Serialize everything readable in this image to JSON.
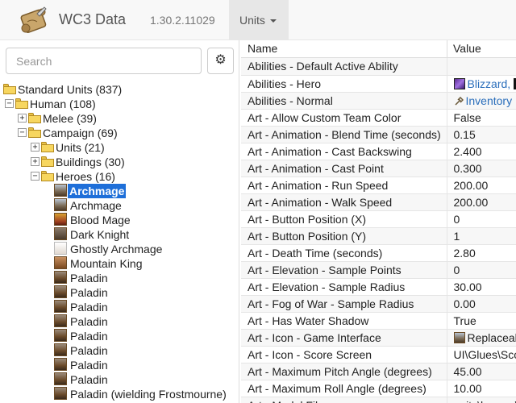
{
  "navbar": {
    "brand": "WC3 Data",
    "version": "1.30.2.11029",
    "menu_label": "Units"
  },
  "search": {
    "placeholder": "Search"
  },
  "tree": {
    "root": "Standard Units (837)",
    "human": "Human (108)",
    "melee": "Melee (39)",
    "campaign": "Campaign (69)",
    "units": "Units (21)",
    "buildings": "Buildings (30)",
    "heroes": "Heroes (16)",
    "hero_items": [
      {
        "label": "Archmage",
        "icon": "archmage-icon",
        "selected": true
      },
      {
        "label": "Archmage",
        "icon": "archmage-icon"
      },
      {
        "label": "Blood Mage",
        "icon": "blood-mage-icon"
      },
      {
        "label": "Dark Knight",
        "icon": "dark-knight-icon"
      },
      {
        "label": "Ghostly Archmage",
        "icon": "ghostly-archmage-icon"
      },
      {
        "label": "Mountain King",
        "icon": "mountain-king-icon"
      },
      {
        "label": "Paladin",
        "icon": "paladin-icon"
      },
      {
        "label": "Paladin",
        "icon": "paladin-icon"
      },
      {
        "label": "Paladin",
        "icon": "paladin-icon"
      },
      {
        "label": "Paladin",
        "icon": "paladin-icon"
      },
      {
        "label": "Paladin",
        "icon": "paladin-icon"
      },
      {
        "label": "Paladin",
        "icon": "paladin-icon"
      },
      {
        "label": "Paladin",
        "icon": "paladin-icon"
      },
      {
        "label": "Paladin",
        "icon": "paladin-icon"
      },
      {
        "label": "Paladin (wielding Frostmourne)",
        "icon": "paladin-icon"
      }
    ]
  },
  "table": {
    "name_header": "Name",
    "value_header": "Value",
    "rows": [
      {
        "name": "Abilities - Default Active Ability",
        "value": ""
      },
      {
        "name": "Abilities - Hero",
        "value": "Blizzard,",
        "link": true,
        "icon": "blizzard-icon"
      },
      {
        "name": "Abilities - Normal",
        "value": "Inventory",
        "link": true,
        "icon": "inventory-icon"
      },
      {
        "name": "Art - Allow Custom Team Color",
        "value": "False"
      },
      {
        "name": "Art - Animation - Blend Time (seconds)",
        "value": "0.15"
      },
      {
        "name": "Art - Animation - Cast Backswing",
        "value": "2.400"
      },
      {
        "name": "Art - Animation - Cast Point",
        "value": "0.300"
      },
      {
        "name": "Art - Animation - Run Speed",
        "value": "200.00"
      },
      {
        "name": "Art - Animation - Walk Speed",
        "value": "200.00"
      },
      {
        "name": "Art - Button Position (X)",
        "value": "0"
      },
      {
        "name": "Art - Button Position (Y)",
        "value": "1"
      },
      {
        "name": "Art - Death Time (seconds)",
        "value": "2.80"
      },
      {
        "name": "Art - Elevation - Sample Points",
        "value": "0"
      },
      {
        "name": "Art - Elevation - Sample Radius",
        "value": "30.00"
      },
      {
        "name": "Art - Fog of War - Sample Radius",
        "value": "0.00"
      },
      {
        "name": "Art - Has Water Shadow",
        "value": "True"
      },
      {
        "name": "Art - Icon - Game Interface",
        "value": "Replaceal",
        "icon": "archmage-icon"
      },
      {
        "name": "Art - Icon - Score Screen",
        "value": "UI\\Glues\\Sco"
      },
      {
        "name": "Art - Maximum Pitch Angle (degrees)",
        "value": "45.00"
      },
      {
        "name": "Art - Maximum Roll Angle (degrees)",
        "value": "10.00"
      },
      {
        "name": "Art - Model File",
        "value": "units\\human\\"
      }
    ]
  }
}
